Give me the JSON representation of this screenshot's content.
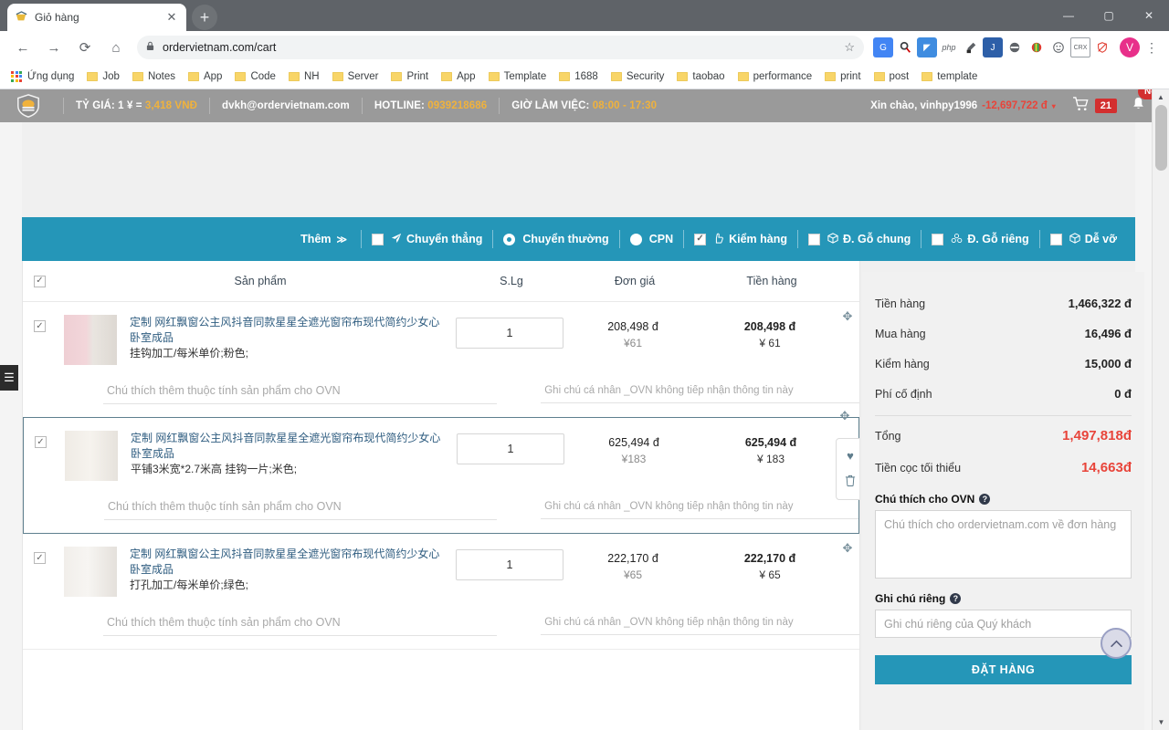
{
  "browser": {
    "tab": {
      "title": "Giỏ hàng",
      "favicon": "cart-favicon",
      "close": "✕"
    },
    "new_tab": "+",
    "window_controls": {
      "minimize": "—",
      "maximize": "▢",
      "close": "✕"
    },
    "nav": {
      "back": "←",
      "forward": "→",
      "reload": "⟳",
      "home": "⌂"
    },
    "omnibox": {
      "lock": "🔒",
      "url": "ordervietnam.com/cart",
      "star": "☆"
    },
    "extensions": [
      "translate-icon",
      "search-lens-icon",
      "grammarly-icon",
      "php-icon",
      "color-picker-icon",
      "json-icon",
      "adblock-icon",
      "rainbow-icon",
      "emoji-icon",
      "crx-icon",
      "shield-off-icon"
    ],
    "profile_initial": "V",
    "menu": "⋮",
    "bookmarks": [
      {
        "label": "Ứng dụng",
        "icon": "apps-grid-icon"
      },
      {
        "label": "Job",
        "icon": "folder-icon"
      },
      {
        "label": "Notes",
        "icon": "folder-icon"
      },
      {
        "label": "App",
        "icon": "folder-icon"
      },
      {
        "label": "Code",
        "icon": "folder-icon"
      },
      {
        "label": "NH",
        "icon": "folder-icon"
      },
      {
        "label": "Server",
        "icon": "folder-icon"
      },
      {
        "label": "Print",
        "icon": "folder-icon"
      },
      {
        "label": "App",
        "icon": "folder-icon"
      },
      {
        "label": "Template",
        "icon": "folder-icon"
      },
      {
        "label": "1688",
        "icon": "folder-icon"
      },
      {
        "label": "Security",
        "icon": "folder-icon"
      },
      {
        "label": "taobao",
        "icon": "folder-icon"
      },
      {
        "label": "performance",
        "icon": "folder-icon"
      },
      {
        "label": "print",
        "icon": "folder-icon"
      },
      {
        "label": "post",
        "icon": "folder-icon"
      },
      {
        "label": "template",
        "icon": "folder-icon"
      }
    ]
  },
  "site_header": {
    "logo": "shield-logo",
    "rate_label": "TỶ GIÁ: 1 ¥ = ",
    "rate_value": "3,418 VNĐ",
    "email": "dvkh@ordervietnam.com",
    "hotline_label": "HOTLINE: ",
    "hotline_value": "0939218686",
    "hours_label": "GIỜ LÀM VIỆC: ",
    "hours_value": "08:00 - 17:30",
    "greeting": "Xin chào, vinhpy1996",
    "balance": "-12,697,722 đ",
    "caret": "▾",
    "cart_icon": "cart-icon",
    "cart_count": "21",
    "bell_icon": "bell-icon",
    "new_badge": "New"
  },
  "ship_bar": {
    "more_label": "Thêm",
    "more_caret": "≫",
    "options": [
      {
        "label": "Chuyển thẳng",
        "control": "checkbox",
        "checked": false,
        "icon": "paper-plane-icon"
      },
      {
        "label": "Chuyển thường",
        "control": "radio",
        "checked": true,
        "icon": ""
      },
      {
        "label": "CPN",
        "control": "radio-filled",
        "checked": false,
        "icon": ""
      },
      {
        "label": "Kiểm hàng",
        "control": "checkbox",
        "checked": true,
        "icon": "hand-check-icon"
      },
      {
        "label": "Đ. Gỗ chung",
        "control": "checkbox",
        "checked": false,
        "icon": "box-icon"
      },
      {
        "label": "Đ. Gỗ riêng",
        "control": "checkbox",
        "checked": false,
        "icon": "boxes-icon"
      },
      {
        "label": "Dễ vỡ",
        "control": "checkbox",
        "checked": false,
        "icon": "fragile-icon"
      }
    ],
    "check_glyph": "✓"
  },
  "table": {
    "select_all_checked": true,
    "headers": {
      "product": "Sản phẩm",
      "qty": "S.Lg",
      "unit_price": "Đơn giá",
      "line_total": "Tiền hàng"
    },
    "rows": [
      {
        "checked": true,
        "image": "pink-curtain-thumbnail",
        "title": "定制 网红飘窗公主风抖音同款星星全遮光窗帘布现代简约少女心卧室成品",
        "attrs": "挂钩加工/每米单价;粉色;",
        "qty": "1",
        "unit_price_vnd": "208,498 đ",
        "unit_price_cny": "¥61",
        "total_vnd": "208,498 đ",
        "total_cny": "¥ 61",
        "note_ovn_placeholder": "Chú thích thêm thuộc tính sản phẩm cho OVN",
        "note_private_placeholder": "Ghi chú cá nhân _OVN không tiếp nhận thông tin này",
        "active": false
      },
      {
        "checked": true,
        "image": "white-curtain-thumbnail",
        "title": "定制 网红飘窗公主风抖音同款星星全遮光窗帘布现代简约少女心卧室成品",
        "attrs": "平铺3米宽*2.7米高 挂钩一片;米色;",
        "qty": "1",
        "unit_price_vnd": "625,494 đ",
        "unit_price_cny": "¥183",
        "total_vnd": "625,494 đ",
        "total_cny": "¥ 183",
        "note_ovn_placeholder": "Chú thích thêm thuộc tính sản phẩm cho OVN",
        "note_private_placeholder": "Ghi chú cá nhân _OVN không tiếp nhận thông tin này",
        "active": true
      },
      {
        "checked": true,
        "image": "sheer-curtain-thumbnail",
        "title": "定制 网红飘窗公主风抖音同款星星全遮光窗帘布现代简约少女心卧室成品",
        "attrs": "打孔加工/每米单价;绿色;",
        "qty": "1",
        "unit_price_vnd": "222,170 đ",
        "unit_price_cny": "¥65",
        "total_vnd": "222,170 đ",
        "total_cny": "¥ 65",
        "note_ovn_placeholder": "Chú thích thêm thuộc tính sản phẩm cho OVN",
        "note_private_placeholder": "Ghi chú cá nhân _OVN không tiếp nhận thông tin này",
        "active": false
      }
    ],
    "row_tools": {
      "favorite": "♥",
      "delete": "🗑",
      "drag": "✥"
    }
  },
  "summary": {
    "lines": [
      {
        "label": "Tiền hàng",
        "value": "1,466,322 đ"
      },
      {
        "label": "Mua hàng",
        "value": "16,496 đ"
      },
      {
        "label": "Kiểm hàng",
        "value": "15,000 đ"
      },
      {
        "label": "Phí cố định",
        "value": "0 đ"
      }
    ],
    "total": {
      "label": "Tổng",
      "value": "1,497,818đ"
    },
    "deposit": {
      "label": "Tiền cọc tối thiểu",
      "value": "14,663đ"
    },
    "ovn_note": {
      "label": "Chú thích cho OVN",
      "help": "?",
      "placeholder": "Chú thích cho ordervietnam.com về đơn hàng"
    },
    "private_note": {
      "label": "Ghi chú riêng",
      "help": "?",
      "placeholder": "Ghi chú riêng của Quý khách"
    },
    "order_button": "ĐẶT HÀNG",
    "scroll_top_icon": "chevron-up-icon"
  },
  "left_drawer": {
    "icon": "☰"
  },
  "scrollbar": {
    "up": "▲",
    "down": "▼"
  },
  "colors": {
    "accent_teal": "#2596b8",
    "header_gray": "#9a9a9a",
    "danger_red": "#e8443a",
    "badge_red": "#d32f2f",
    "link_blue": "#2f5d80",
    "highlight_orange": "#f0b23c"
  }
}
